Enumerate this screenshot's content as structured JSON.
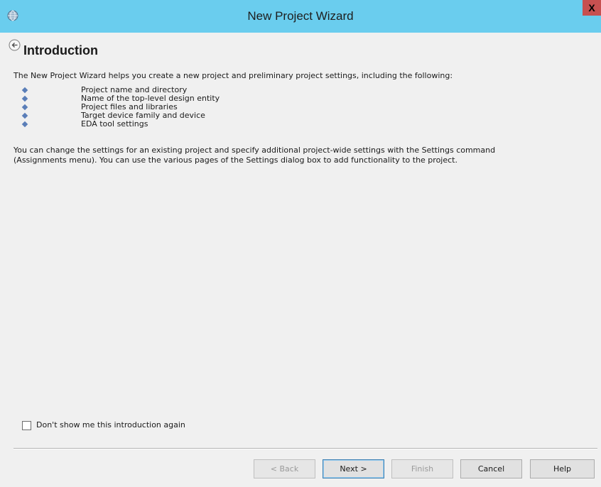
{
  "window": {
    "title": "New Project Wizard",
    "close_label": "X",
    "accent_color": "#6acdee"
  },
  "page": {
    "heading": "Introduction",
    "intro": "The New Project Wizard helps you create a new project and preliminary project settings, including the following:",
    "items": [
      "Project name and directory",
      "Name of the top-level design entity",
      "Project files and libraries",
      "Target device family and device",
      "EDA tool settings"
    ],
    "paragraph_line1": "You can change the settings for an existing project and specify additional project-wide settings with the Settings command",
    "paragraph_line2": "(Assignments menu). You can use the various pages of the Settings dialog box to add functionality to the project."
  },
  "checkbox": {
    "label": "Don't show me this introduction again",
    "checked": false
  },
  "buttons": {
    "back": "< Back",
    "next": "Next >",
    "finish": "Finish",
    "cancel": "Cancel",
    "help": "Help"
  }
}
